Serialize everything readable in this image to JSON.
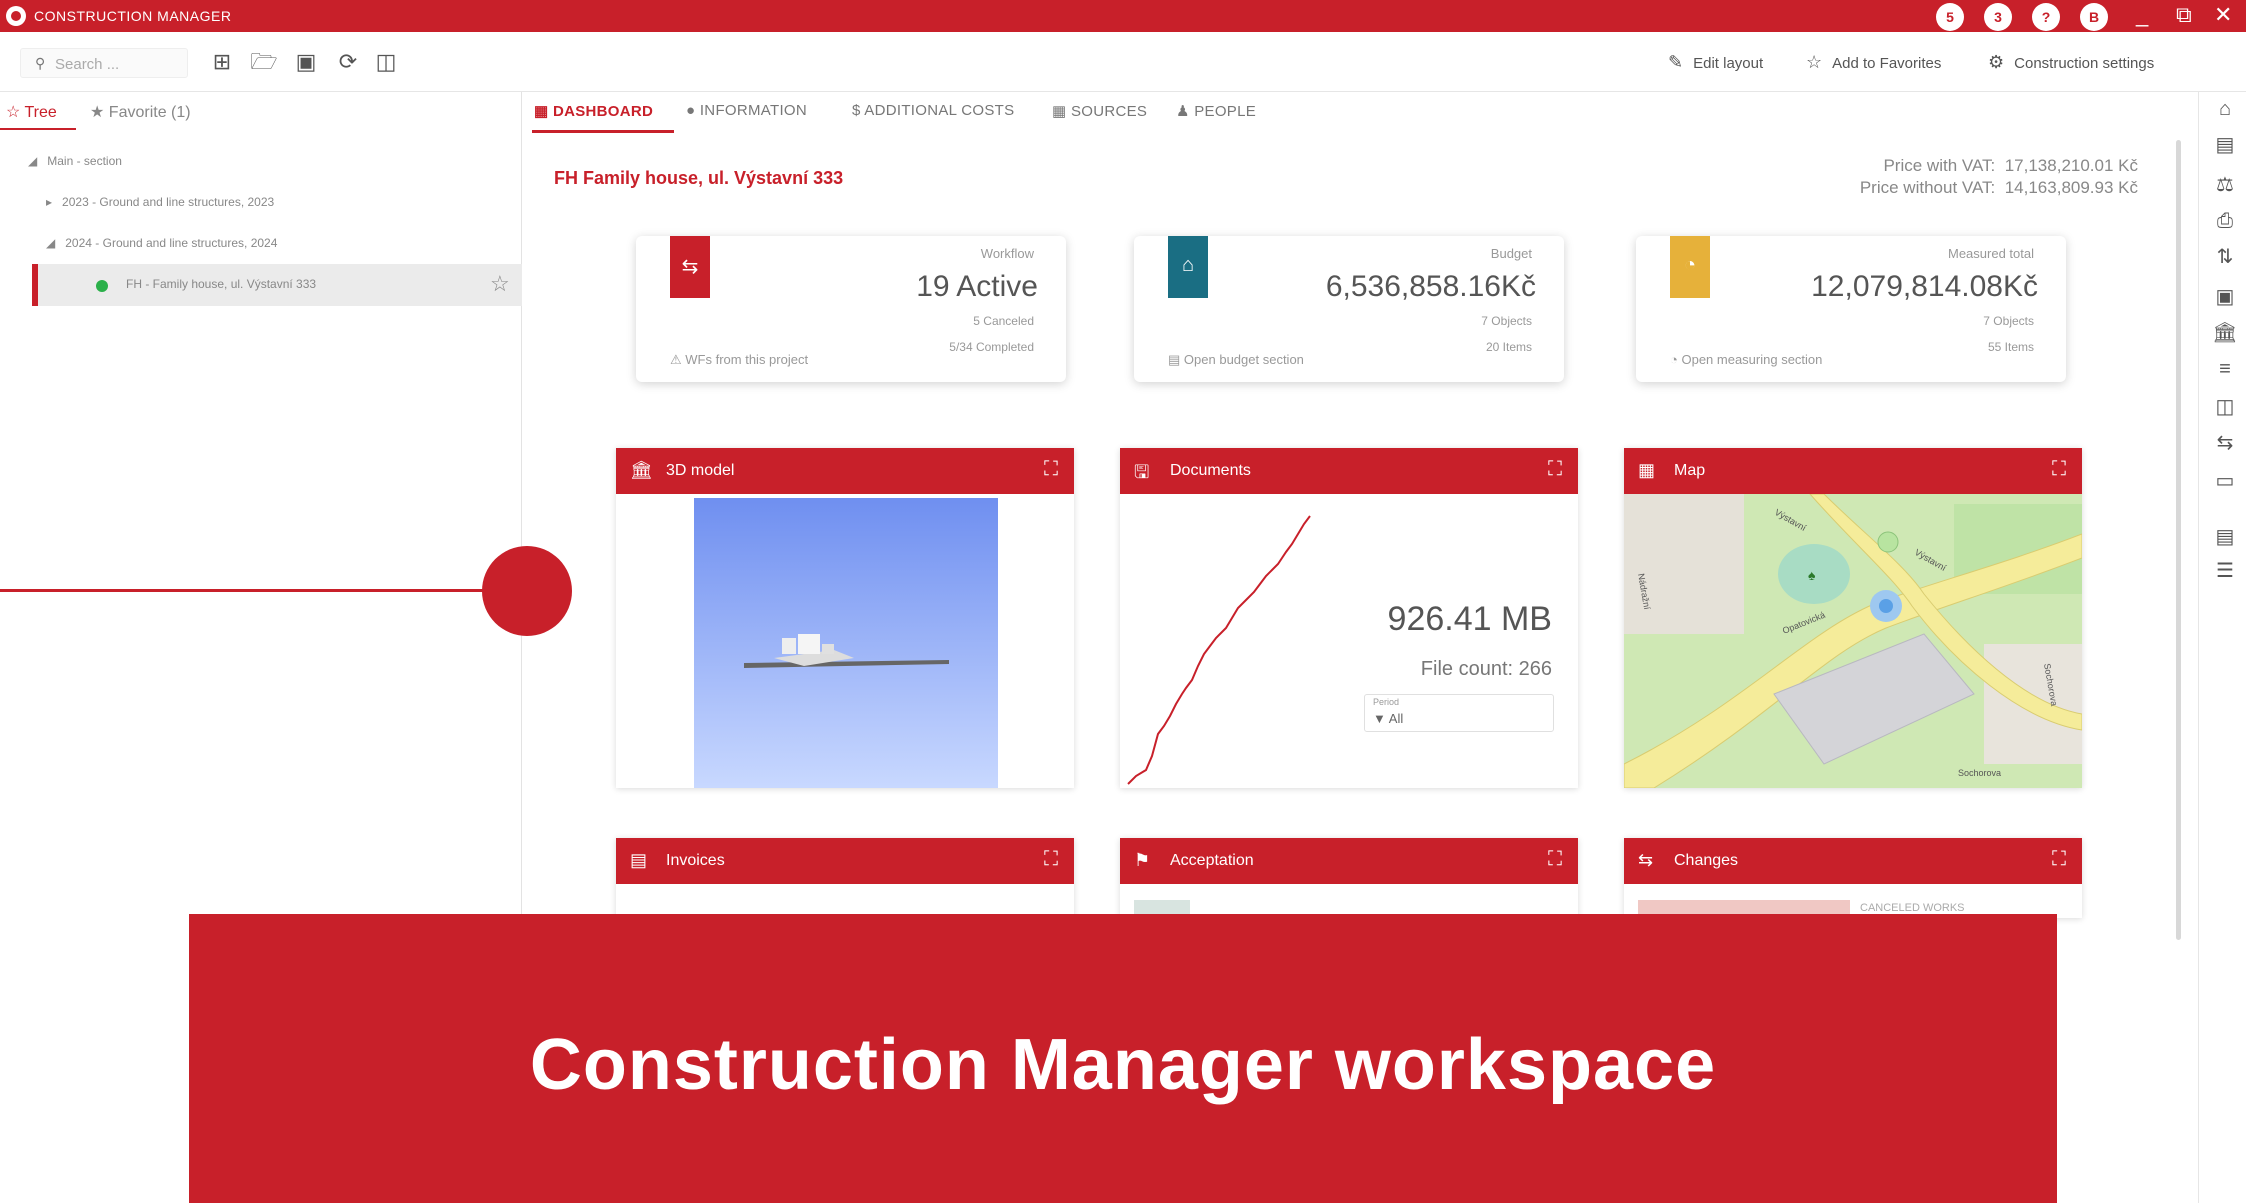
{
  "window": {
    "title": "CONSTRUCTION MANAGER",
    "status_circles": [
      "5",
      "3",
      "?",
      "B"
    ],
    "controls": [
      "_",
      "⧉",
      "✕"
    ]
  },
  "toolbar": {
    "search_placeholder": "Search ...",
    "icons": [
      "add-icon",
      "add-folder-icon",
      "save-icon",
      "refresh-icon",
      "delete-icon"
    ],
    "edit_layout": "Edit layout",
    "add_favorites": "Add to Favorites",
    "settings": "Construction settings"
  },
  "left_panel": {
    "tab_tree": "Tree",
    "tab_favorite": "Favorite (1)",
    "tree": [
      {
        "label": "Main - section",
        "level": 0,
        "expanded": true
      },
      {
        "label": "2023 - Ground and line structures, 2023",
        "level": 1,
        "expanded": false
      },
      {
        "label": "2024 - Ground and line structures, 2024",
        "level": 1,
        "expanded": true
      },
      {
        "label": "FH - Family house, ul. Výstavní 333",
        "level": 2,
        "selected": true
      }
    ]
  },
  "tabs": {
    "dashboard": "DASHBOARD",
    "information": "INFORMATION",
    "additional_costs": "ADDITIONAL COSTS",
    "sources": "SOURCES",
    "people": "PEOPLE"
  },
  "project": {
    "title": "FH Family house, ul. Výstavní 333",
    "price_with_vat_label": "Price with VAT:",
    "price_with_vat": "17,138,210.01 Kč",
    "price_without_vat_label": "Price without VAT:",
    "price_without_vat": "14,163,809.93 Kč"
  },
  "cards": {
    "workflow": {
      "label": "Workflow",
      "value": "19 Active",
      "sub1": "5 Canceled",
      "sub2": "5/34 Completed",
      "link": "WFs from this project",
      "color": "#c8202a"
    },
    "budget": {
      "label": "Budget",
      "value": "6,536,858.16Kč",
      "sub1": "7 Objects",
      "sub2": "20 Items",
      "link": "Open budget section",
      "color": "#1a6e83"
    },
    "measured": {
      "label": "Measured total",
      "value": "12,079,814.08Kč",
      "sub1": "7 Objects",
      "sub2": "55 Items",
      "link": "Open measuring section",
      "color": "#e6b13a"
    }
  },
  "widgets": {
    "model": {
      "title": "3D model"
    },
    "documents": {
      "title": "Documents",
      "size": "926.41 MB",
      "file_count": "File count: 266",
      "period_label": "Period",
      "period_value": "All"
    },
    "map": {
      "title": "Map",
      "streets": [
        "Výstavní",
        "Výstavní",
        "Nádražní",
        "Opatovická",
        "Sochorova",
        "Sochorova"
      ]
    },
    "invoices": {
      "title": "Invoices"
    },
    "acceptation": {
      "title": "Acceptation"
    },
    "changes": {
      "title": "Changes",
      "legend": "CANCELED WORKS"
    }
  },
  "overlay": {
    "caption": "Construction Manager workspace"
  },
  "colors": {
    "accent": "#c8202a",
    "budget": "#1a6e83",
    "measured": "#e6b13a"
  }
}
